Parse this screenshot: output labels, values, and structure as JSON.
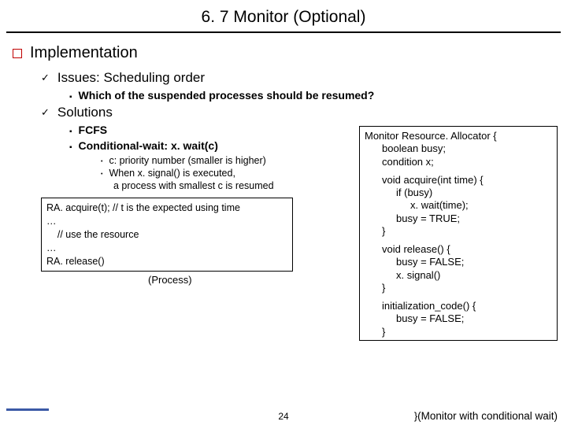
{
  "title": "6. 7 Monitor (Optional)",
  "h1": "Implementation",
  "sec1": {
    "heading": "Issues: Scheduling order",
    "bullet1": "Which of the suspended processes should be resumed?"
  },
  "sec2": {
    "heading": "Solutions",
    "b1": "FCFS",
    "b2": "Conditional-wait: x. wait(c)",
    "s1": "c: priority number (smaller is higher)",
    "s2": "When x. signal() is executed,",
    "s2b": "a process with smallest c is resumed"
  },
  "process": {
    "l1": "RA. acquire(t);   // t is the expected using time",
    "l2": "…",
    "l3": "    // use the resource",
    "l4": "…",
    "l5": "RA. release()",
    "label": "(Process)"
  },
  "monitor": {
    "l1": "Monitor Resource. Allocator {",
    "l2": "boolean busy;",
    "l3": "condition x;",
    "a1": "void acquire(int time) {",
    "a2": "if (busy)",
    "a3": "x. wait(time);",
    "a4": "busy = TRUE;",
    "a5": "}",
    "r1": "void release() {",
    "r2": "busy = FALSE;",
    "r3": "x. signal()",
    "r4": "}",
    "i1": "initialization_code() {",
    "i2": "busy = FALSE;",
    "i3": "}",
    "label_open": "}",
    "label_text": "(Monitor with conditional wait)"
  },
  "pagenum": "24"
}
